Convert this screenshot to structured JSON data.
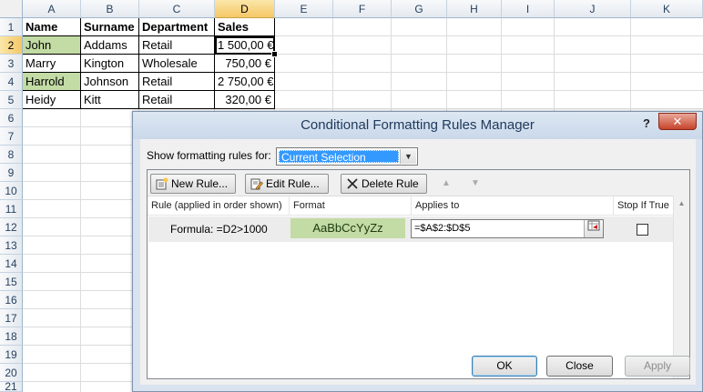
{
  "columns": [
    "A",
    "B",
    "C",
    "D",
    "E",
    "F",
    "G",
    "H",
    "I",
    "J",
    "K"
  ],
  "rows": [
    "1",
    "2",
    "3",
    "4",
    "5",
    "6",
    "7",
    "8",
    "9",
    "10",
    "11",
    "12",
    "13",
    "14",
    "15",
    "16",
    "17",
    "18",
    "19",
    "20",
    "21"
  ],
  "sheet": {
    "headers": [
      "Name",
      "Surname",
      "Department",
      "Sales"
    ],
    "data": [
      [
        "John",
        "Addams",
        "Retail",
        "1 500,00 €"
      ],
      [
        "Marry",
        "Kington",
        "Wholesale",
        "750,00 €"
      ],
      [
        "Harrold",
        "Johnson",
        "Retail",
        "2 750,00 €"
      ],
      [
        "Heidy",
        "Kitt",
        "Retail",
        "320,00 €"
      ]
    ],
    "highlight_color": "#c3dba4"
  },
  "dialog": {
    "title": "Conditional Formatting Rules Manager",
    "help": "?",
    "close": "✕",
    "show_label": "Show formatting rules for:",
    "show_value": "Current Selection",
    "toolbar": {
      "new_rule": "New Rule...",
      "edit_rule": "Edit Rule...",
      "delete_rule": "Delete Rule"
    },
    "columns": {
      "rule": "Rule (applied in order shown)",
      "format": "Format",
      "applies_to": "Applies to",
      "stop_if_true": "Stop If True"
    },
    "rule": {
      "description": "Formula: =D2>1000",
      "format_preview": "AaBbCcYyZz",
      "applies_to": "=$A$2:$D$5",
      "stop_if_true": false
    },
    "buttons": {
      "ok": "OK",
      "close": "Close",
      "apply": "Apply"
    }
  }
}
